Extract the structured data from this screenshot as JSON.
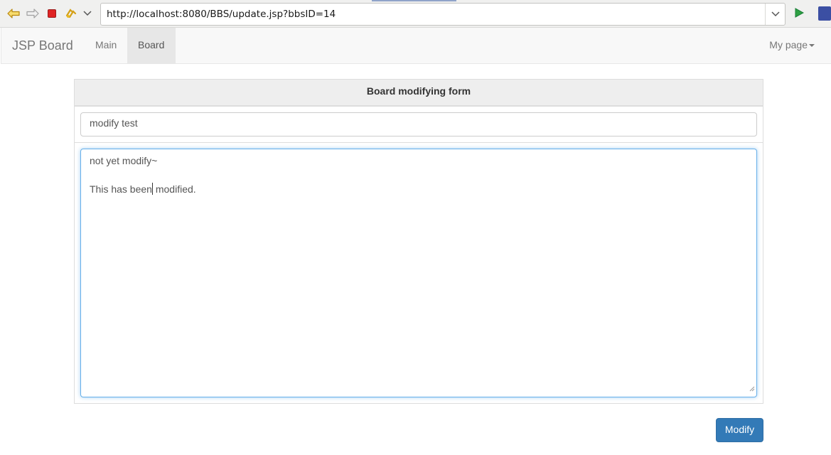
{
  "browser": {
    "url": "http://localhost:8080/BBS/update.jsp?bbsID=14",
    "icons": [
      "back-arrow-icon",
      "forward-arrow-icon",
      "stop-icon",
      "reload-icon",
      "history-dropdown-icon",
      "url-dropdown-icon",
      "go-icon",
      "extension-icon"
    ]
  },
  "navbar": {
    "brand": "JSP Board",
    "items": [
      {
        "label": "Main",
        "active": false
      },
      {
        "label": "Board",
        "active": true
      }
    ],
    "right_menu": "My page"
  },
  "form": {
    "heading": "Board modifying form",
    "title_value": "modify test",
    "content_lines": [
      "not yet modify~",
      "",
      "This has been",
      " modified."
    ],
    "submit_label": "Modify"
  },
  "colors": {
    "primary": "#337ab7",
    "focus_border": "#66afe9",
    "navbar_bg": "#f8f8f8"
  }
}
